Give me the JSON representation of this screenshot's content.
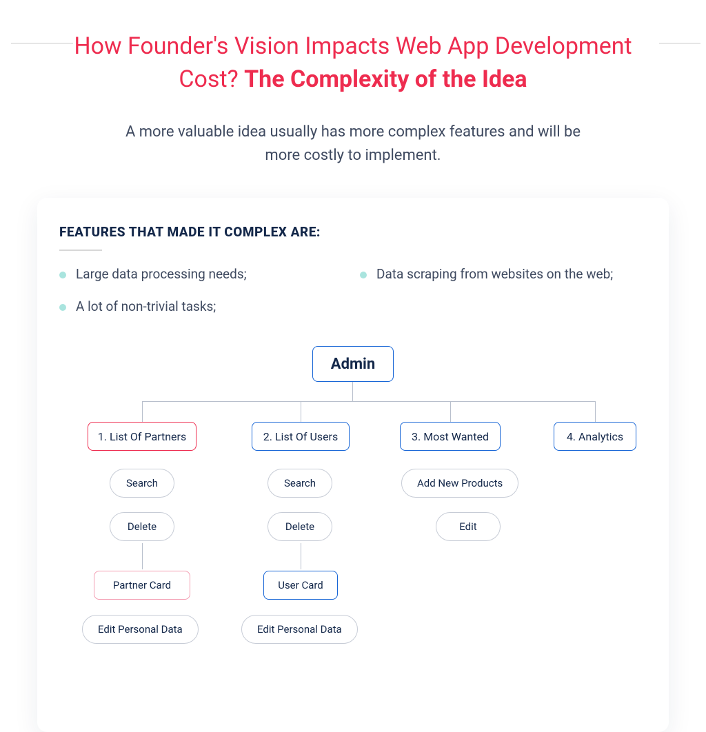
{
  "title": {
    "normal": "How Founder's Vision Impacts Web App Development Cost? ",
    "bold": "The Complexity of the Idea"
  },
  "subtitle": "A more valuable idea usually has more complex features and will be more costly to implement.",
  "section_heading": "FEATURES THAT MADE IT COMPLEX ARE:",
  "bullets": {
    "b1": "Large data processing needs;",
    "b2": "Data scraping from websites on the web;",
    "b3": "A lot of non-trivial tasks;"
  },
  "diagram": {
    "root": "Admin",
    "branches": {
      "partners": "1. List Of Partners",
      "users": "2. List Of Users",
      "most_wanted": "3. Most Wanted",
      "analytics": "4. Analytics"
    },
    "col1": {
      "search": "Search",
      "delete": "Delete",
      "card": "Partner Card",
      "edit": "Edit Personal Data"
    },
    "col2": {
      "search": "Search",
      "delete": "Delete",
      "card": "User Card",
      "edit": "Edit Personal Data"
    },
    "col3": {
      "add": "Add New Products",
      "edit": "Edit"
    }
  }
}
